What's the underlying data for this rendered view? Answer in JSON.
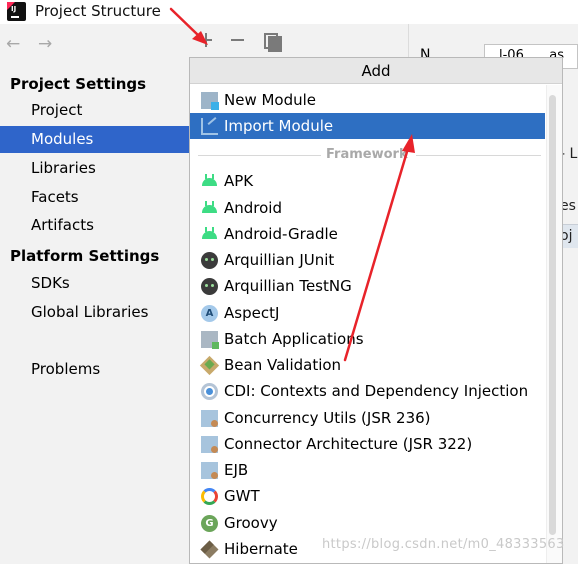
{
  "window": {
    "title": "Project Structure",
    "app_icon": "intellij-idea-icon"
  },
  "nav": {
    "back_icon": "arrow-left-icon",
    "forward_icon": "arrow-right-icon",
    "back_glyph": "←",
    "forward_glyph": "→"
  },
  "sidebar": {
    "project_settings_heading": "Project Settings",
    "project_items": [
      "Project",
      "Modules",
      "Libraries",
      "Facets",
      "Artifacts"
    ],
    "selected_item": "Modules",
    "platform_settings_heading": "Platform Settings",
    "platform_items": [
      "SDKs",
      "Global Libraries"
    ],
    "problems": "Problems"
  },
  "toolbar": {
    "add_icon": "plus-icon",
    "remove_icon": "minus-icon",
    "copy_icon": "copy-icon"
  },
  "right_panel": {
    "name_label_partial": "N",
    "name_value_partial": "l-06_..._as",
    "edge_text_1": "- L",
    "edge_text_2": "es",
    "edge_text_3": "oj"
  },
  "popup": {
    "title": "Add",
    "top_items": [
      {
        "label": "New Module",
        "icon": "new-module-icon"
      },
      {
        "label": "Import Module",
        "icon": "import-module-icon",
        "selected": true
      }
    ],
    "separator": "Framework",
    "framework_items": [
      {
        "label": "APK",
        "icon": "android-icon"
      },
      {
        "label": "Android",
        "icon": "android-icon"
      },
      {
        "label": "Android-Gradle",
        "icon": "android-icon"
      },
      {
        "label": "Arquillian JUnit",
        "icon": "arquillian-icon"
      },
      {
        "label": "Arquillian TestNG",
        "icon": "arquillian-icon"
      },
      {
        "label": "AspectJ",
        "icon": "aspectj-icon"
      },
      {
        "label": "Batch Applications",
        "icon": "batch-icon"
      },
      {
        "label": "Bean Validation",
        "icon": "bean-validation-icon"
      },
      {
        "label": "CDI: Contexts and Dependency Injection",
        "icon": "cdi-icon"
      },
      {
        "label": "Concurrency Utils (JSR 236)",
        "icon": "concurrency-icon"
      },
      {
        "label": "Connector Architecture (JSR 322)",
        "icon": "connector-icon"
      },
      {
        "label": "EJB",
        "icon": "ejb-icon"
      },
      {
        "label": "GWT",
        "icon": "gwt-icon"
      },
      {
        "label": "Groovy",
        "icon": "groovy-icon"
      },
      {
        "label": "Hibernate",
        "icon": "hibernate-icon"
      }
    ],
    "aspectj_glyph": "A",
    "groovy_glyph": "G"
  },
  "watermark": "https://blog.csdn.net/m0_48333563",
  "colors": {
    "selection": "#2f65ca",
    "annotation_arrow": "#e8232a"
  }
}
